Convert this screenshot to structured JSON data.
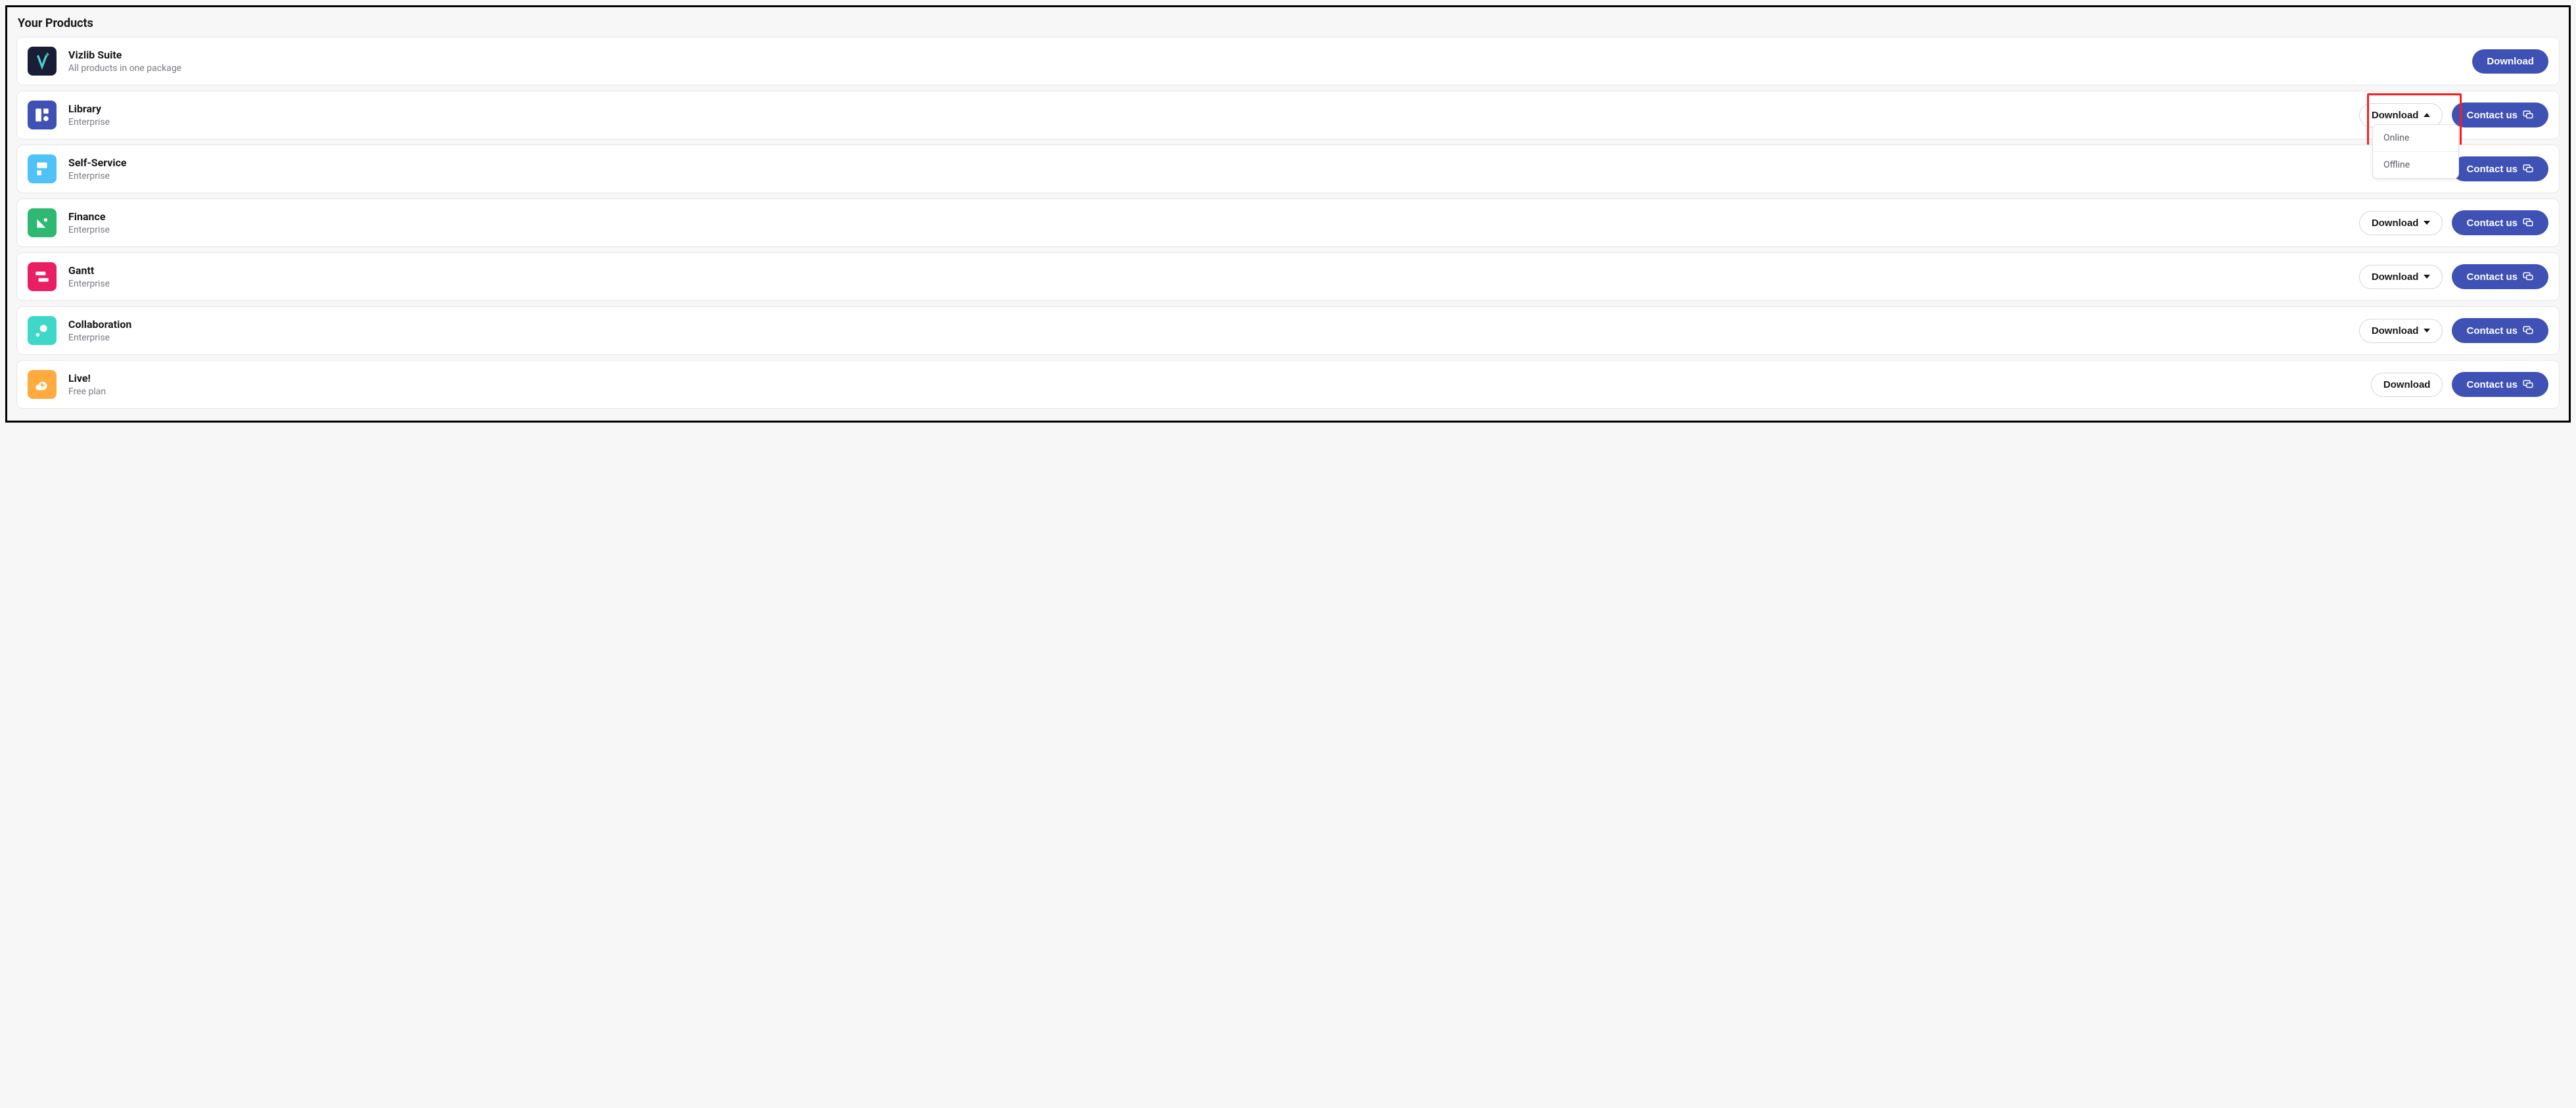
{
  "section_title": "Your Products",
  "buttons": {
    "download": "Download",
    "contact": "Contact us"
  },
  "dropdown": {
    "online": "Online",
    "offline": "Offline"
  },
  "products": [
    {
      "name": "Vizlib Suite",
      "sub": "All products in one package"
    },
    {
      "name": "Library",
      "sub": "Enterprise"
    },
    {
      "name": "Self-Service",
      "sub": "Enterprise"
    },
    {
      "name": "Finance",
      "sub": "Enterprise"
    },
    {
      "name": "Gantt",
      "sub": "Enterprise"
    },
    {
      "name": "Collaboration",
      "sub": "Enterprise"
    },
    {
      "name": "Live!",
      "sub": "Free plan"
    }
  ]
}
